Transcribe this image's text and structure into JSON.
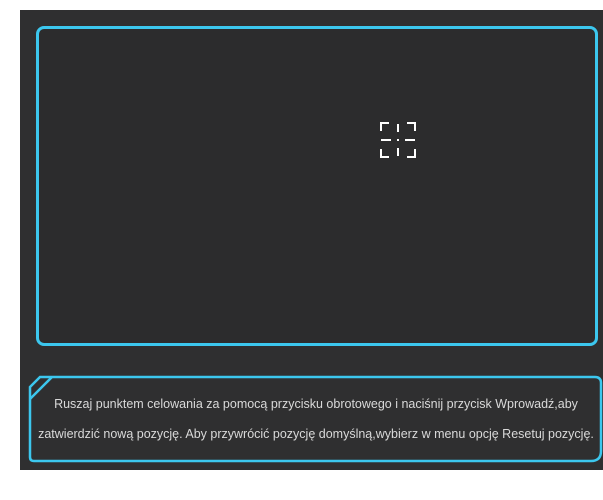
{
  "colors": {
    "background": "#2f2f30",
    "accent": "#3cc7ee",
    "text": "#d9d9d9"
  },
  "preview": {
    "crosshair_icon": "crosshair-icon"
  },
  "info": {
    "line1": "Ruszaj punktem celowania za pomocą przycisku obrotowego i naciśnij przycisk Wprowadź,aby",
    "line2": "zatwierdzić nową pozycję. Aby przywrócić pozycję domyślną,wybierz w menu opcję Resetuj pozycję."
  }
}
